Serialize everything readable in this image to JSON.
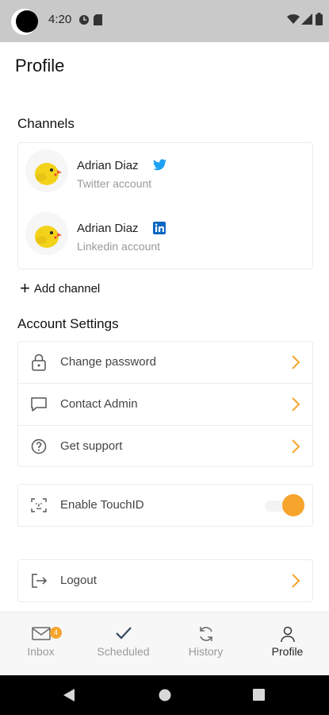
{
  "status_bar": {
    "time": "4:20"
  },
  "page": {
    "title": "Profile"
  },
  "channels": {
    "section_title": "Channels",
    "items": [
      {
        "name": "Adrian Diaz",
        "subtitle": "Twitter account",
        "network_icon": "twitter-icon",
        "color": "#1da1f2"
      },
      {
        "name": "Adrian Diaz",
        "subtitle": "Linkedin account",
        "network_icon": "linkedin-icon",
        "color": "#0a66c2"
      }
    ],
    "add_label": "Add channel"
  },
  "account_settings": {
    "section_title": "Account Settings",
    "items": [
      {
        "label": "Change password",
        "icon": "lock-icon"
      },
      {
        "label": "Contact Admin",
        "icon": "chat-icon"
      },
      {
        "label": "Get support",
        "icon": "help-icon"
      }
    ]
  },
  "touch_id": {
    "label": "Enable TouchID",
    "icon": "face-scan-icon",
    "enabled": true
  },
  "logout": {
    "label": "Logout",
    "icon": "logout-icon"
  },
  "tab_bar": {
    "tabs": [
      {
        "label": "Inbox",
        "icon": "inbox-icon",
        "badge": "4"
      },
      {
        "label": "Scheduled",
        "icon": "check-icon"
      },
      {
        "label": "History",
        "icon": "refresh-icon"
      },
      {
        "label": "Profile",
        "icon": "person-icon",
        "active": true
      }
    ]
  },
  "colors": {
    "accent": "#f6a42c",
    "muted_text": "#9a9a9a",
    "border": "#ececec"
  }
}
